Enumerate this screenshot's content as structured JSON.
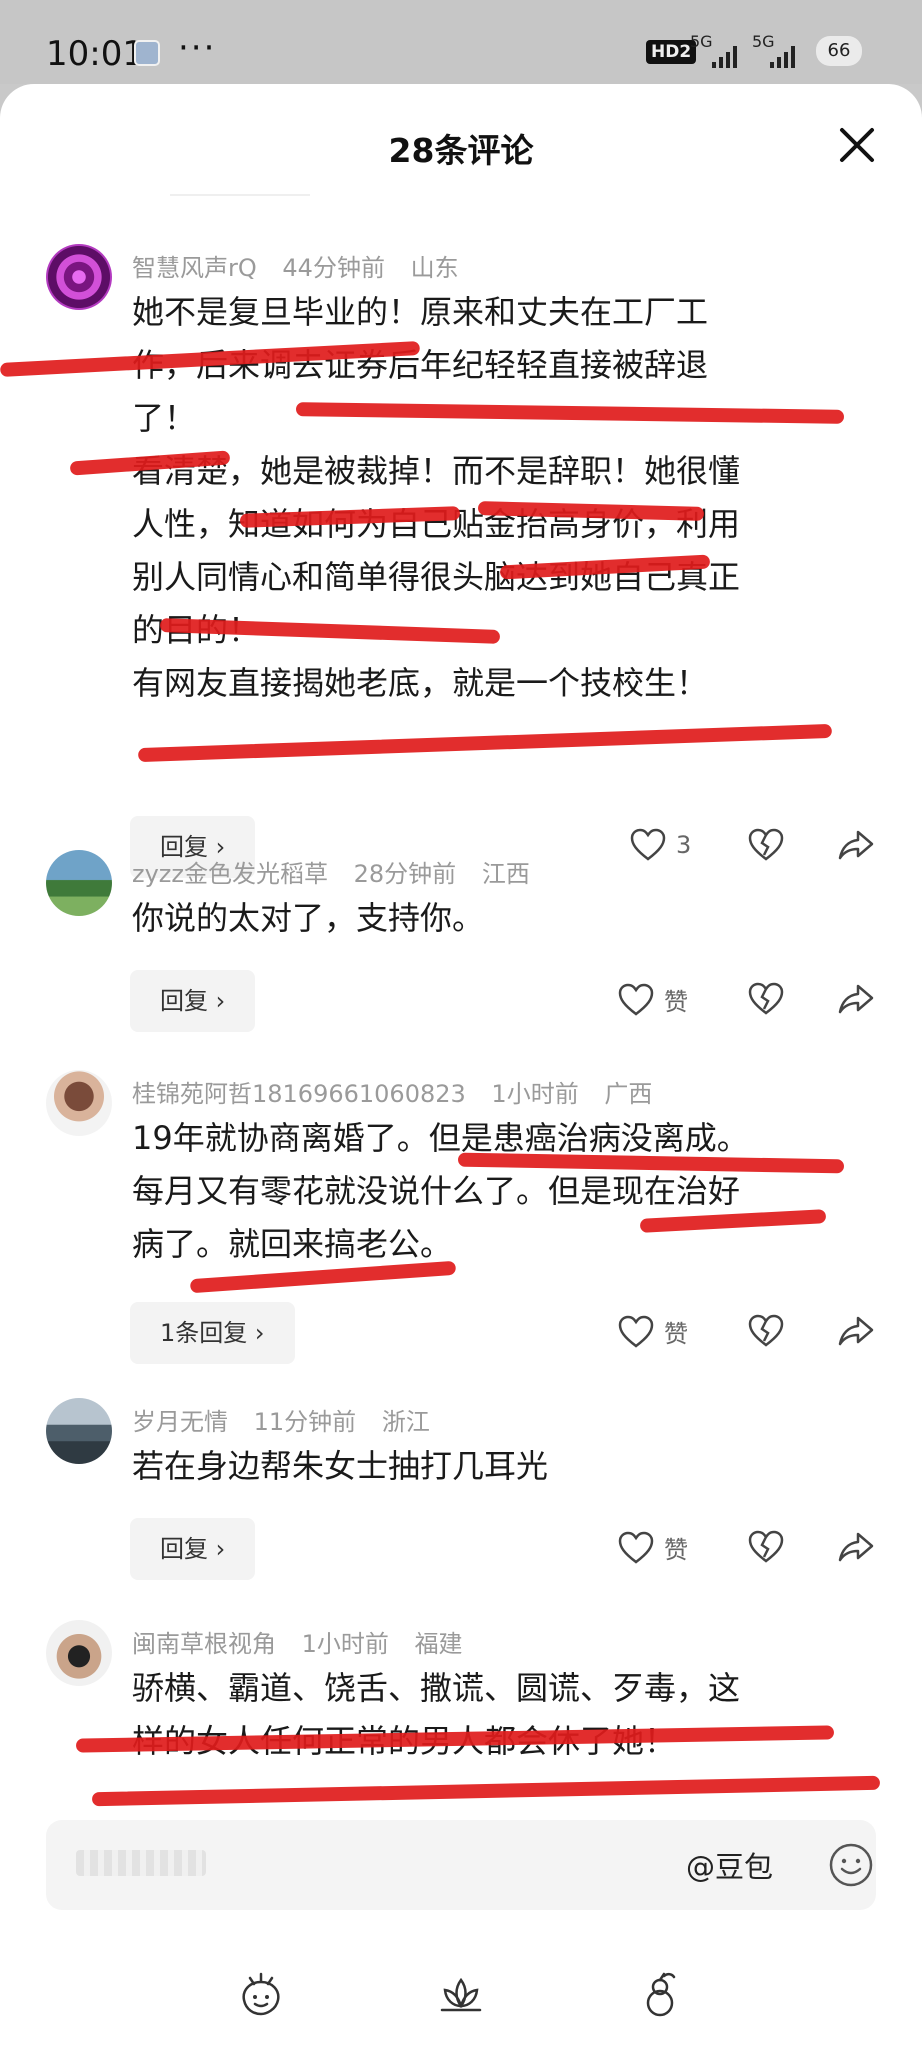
{
  "status_bar": {
    "time": "10:01",
    "more_dots": "···",
    "hd_label": "HD2",
    "network_1": "5G",
    "network_2": "5G",
    "battery": "66"
  },
  "sheet": {
    "title": "28条评论"
  },
  "comments": [
    {
      "user": "智慧风声rQ",
      "time": "44分钟前",
      "location": "山东",
      "lines": [
        "她不是复旦毕业的！原来和丈夫在工厂工",
        "作，后来调去证券后年纪轻轻直接被辞退",
        "了！",
        "看清楚，她是被裁掉！而不是辞职！她很懂",
        "人性，知道如何为自己贴金抬高身价，利用",
        "别人同情心和简单得很头脑达到她自己真正",
        "的目的！",
        "有网友直接揭她老底，就是一个技校生！"
      ],
      "reply_label": "回复 ›",
      "like_count": "3"
    },
    {
      "user": "zyzz金色发光稻草",
      "time": "28分钟前",
      "location": "江西",
      "lines": [
        "你说的太对了，支持你。"
      ],
      "reply_label": "回复 ›",
      "like_count": "赞"
    },
    {
      "user": "桂锦苑阿哲18169661060823",
      "time": "1小时前",
      "location": "广西",
      "lines": [
        "19年就协商离婚了。但是患癌治病没离成。",
        "每月又有零花就没说什么了。但是现在治好",
        "病了。就回来搞老公。"
      ],
      "reply_label": "1条回复 ›",
      "like_count": "赞"
    },
    {
      "user": "岁月无情",
      "time": "11分钟前",
      "location": "浙江",
      "lines": [
        "若在身边帮朱女士抽打几耳光"
      ],
      "reply_label": "回复 ›",
      "like_count": "赞"
    },
    {
      "user": "闽南草根视角",
      "time": "1小时前",
      "location": "福建",
      "lines": [
        "骄横、霸道、饶舌、撒谎、圆谎、歹毒，这",
        "样的女人任何正常的男人都会休了她！"
      ]
    }
  ],
  "input_bar": {
    "mention": "@豆包"
  },
  "icons": {
    "close": "close-icon",
    "like": "heart-icon",
    "dislike": "broken-heart-icon",
    "share": "share-arrow-icon",
    "emoji": "smiley-icon"
  },
  "colors": {
    "annotation_red": "#e01b1b",
    "meta_gray": "#9a9a9a"
  }
}
